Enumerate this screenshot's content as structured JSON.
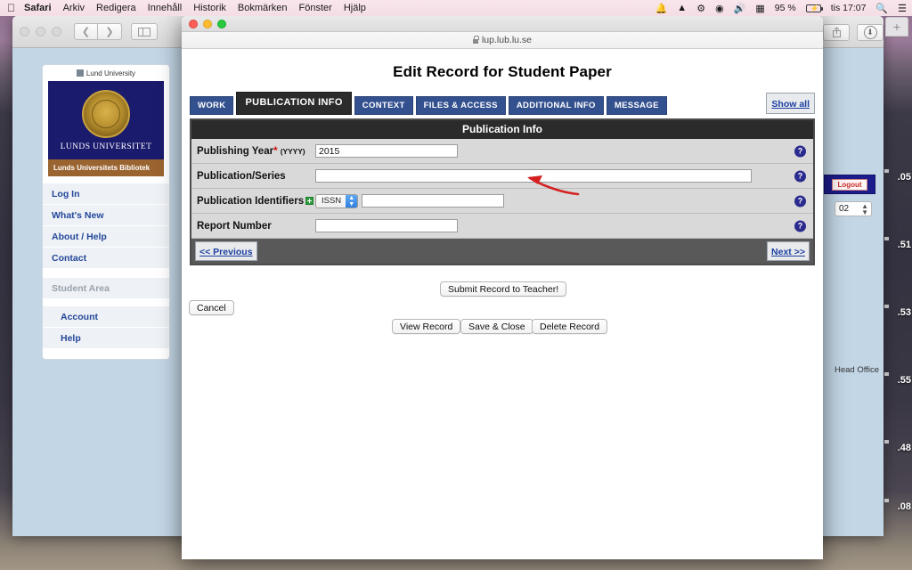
{
  "menubar": {
    "apple_icon": "apple-icon",
    "items": [
      {
        "label": "Safari",
        "bold": true
      },
      {
        "label": "Arkiv",
        "bold": false
      },
      {
        "label": "Redigera",
        "bold": false
      },
      {
        "label": "Innehåll",
        "bold": false
      },
      {
        "label": "Historik",
        "bold": false
      },
      {
        "label": "Bokmärken",
        "bold": false
      },
      {
        "label": "Fönster",
        "bold": false
      },
      {
        "label": "Hjälp",
        "bold": false
      }
    ],
    "status_icons": [
      "bell-icon",
      "drive-icon",
      "bluetooth-icon",
      "dropbox-icon",
      "volume-icon",
      "display-icon"
    ],
    "battery_percent": "95 %",
    "clock": "tis 17:07",
    "search_icon": "search-icon",
    "notification_center_icon": "list-icon"
  },
  "background_window": {
    "toolbar": {
      "back_icon": "chevron-left-icon",
      "forward_icon": "chevron-right-icon",
      "sidebar_icon": "sidebar-icon",
      "share_icon": "share-icon",
      "downloads_icon": "download-icon",
      "new_tab_label": "+"
    },
    "sidebar": {
      "university_label": "Lund University",
      "crest_label": "LUNDS UNIVERSITET",
      "library_label": "Lunds Universitets Bibliotek",
      "links": [
        "Log In",
        "What's New",
        "About / Help",
        "Contact"
      ],
      "section_header": "Student Area",
      "sub_links": [
        "Account",
        "Help"
      ]
    },
    "logout_label": "Logout",
    "spinner_value": "02",
    "head_office_label": "Head Office",
    "edge_numbers": [
      ".05",
      ".51",
      ".53",
      ".55",
      ".48",
      ".08"
    ]
  },
  "dialog": {
    "url": "lup.lub.lu.se",
    "lock_icon": "lock-icon",
    "title": "Edit Record for Student Paper",
    "tabs": [
      {
        "label": "WORK",
        "active": false
      },
      {
        "label": "PUBLICATION INFO",
        "active": true
      },
      {
        "label": "CONTEXT",
        "active": false
      },
      {
        "label": "FILES & ACCESS",
        "active": false
      },
      {
        "label": "ADDITIONAL INFO",
        "active": false
      },
      {
        "label": "MESSAGE",
        "active": false
      }
    ],
    "show_all_label": "Show all",
    "panel_title": "Publication Info",
    "fields": {
      "publishing_year": {
        "label": "Publishing Year",
        "required_mark": "*",
        "hint": "(YYYY)",
        "value": "2015",
        "help_icon": "help-icon"
      },
      "publication_series": {
        "label": "Publication/Series",
        "value": "",
        "help_icon": "help-icon"
      },
      "publication_identifiers": {
        "label": "Publication Identifiers",
        "add_icon": "plus-icon",
        "select_value": "ISSN",
        "value": "",
        "help_icon": "help-icon"
      },
      "report_number": {
        "label": "Report Number",
        "value": "",
        "help_icon": "help-icon"
      }
    },
    "nav": {
      "previous_label": "<< Previous",
      "next_label": "Next >>"
    },
    "buttons": {
      "submit": "Submit Record to Teacher!",
      "cancel": "Cancel",
      "view": "View Record",
      "save": "Save & Close",
      "delete": "Delete Record"
    },
    "annotation": {
      "type": "red-arrow",
      "color": "#d42020",
      "points_to": "publishing-year-input"
    }
  }
}
